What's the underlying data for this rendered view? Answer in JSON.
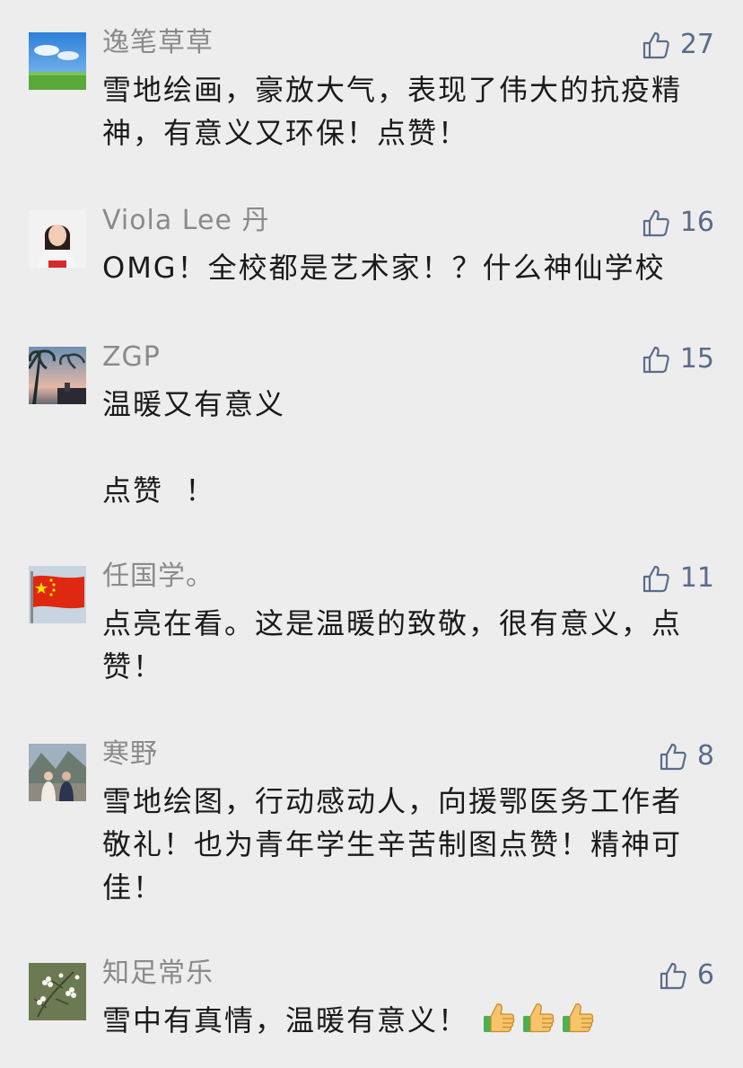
{
  "comments": [
    {
      "author": "逸笔草草",
      "avatar": "landscape-sky-avatar",
      "likes": "27",
      "text": "雪地绘画，豪放大气，表现了伟大的抗疫精神，有意义又环保！点赞！"
    },
    {
      "author": "Viola Lee 丹",
      "avatar": "woman-portrait-avatar",
      "likes": "16",
      "text": "OMG！全校都是艺术家！？什么神仙学校"
    },
    {
      "author": "ZGP",
      "avatar": "palm-sunset-avatar",
      "likes": "15",
      "text": "温暖又有意义\n\n点赞  ！"
    },
    {
      "author": "任国学。",
      "avatar": "china-flag-avatar",
      "likes": "11",
      "text": "点亮在看。这是温暖的致敬，很有意义，点赞！"
    },
    {
      "author": "寒野",
      "avatar": "people-outdoor-avatar",
      "likes": "8",
      "text": "雪地绘图，行动感动人，向援鄂医务工作者敬礼！也为青年学生辛苦制图点赞！精神可佳！"
    },
    {
      "author": "知足常乐",
      "avatar": "white-flower-avatar",
      "likes": "6",
      "text": "雪中有真情，温暖有意义！",
      "emojis": [
        "thumbs-up-emoji",
        "thumbs-up-emoji",
        "thumbs-up-emoji"
      ]
    }
  ],
  "colors": {
    "background": "#ededed",
    "author": "#8a8a8a",
    "like": "#5b6b8c",
    "text": "#1a1a1a"
  }
}
